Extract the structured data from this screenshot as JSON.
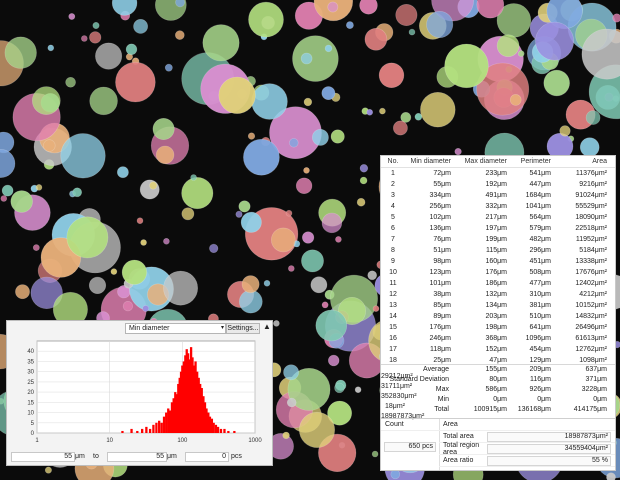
{
  "background": {
    "color": "#0b0b0b"
  },
  "results": {
    "columns": [
      "No.",
      "Min diameter",
      "Max diameter",
      "Perimeter",
      "Area"
    ],
    "rows": [
      [
        "1",
        "72μm",
        "233μm",
        "541μm",
        "11376μm²"
      ],
      [
        "2",
        "55μm",
        "192μm",
        "447μm",
        "9216μm²"
      ],
      [
        "3",
        "334μm",
        "491μm",
        "1684μm",
        "91024μm²"
      ],
      [
        "4",
        "256μm",
        "332μm",
        "1041μm",
        "55529μm²"
      ],
      [
        "5",
        "102μm",
        "217μm",
        "564μm",
        "18090μm²"
      ],
      [
        "6",
        "136μm",
        "197μm",
        "579μm",
        "22518μm²"
      ],
      [
        "7",
        "76μm",
        "199μm",
        "482μm",
        "11952μm²"
      ],
      [
        "8",
        "51μm",
        "115μm",
        "296μm",
        "5184μm²"
      ],
      [
        "9",
        "98μm",
        "160μm",
        "451μm",
        "13338μm²"
      ],
      [
        "10",
        "123μm",
        "176μm",
        "508μm",
        "17676μm²"
      ],
      [
        "11",
        "101μm",
        "186μm",
        "477μm",
        "12402μm²"
      ],
      [
        "12",
        "38μm",
        "132μm",
        "310μm",
        "4212μm²"
      ],
      [
        "13",
        "85μm",
        "134μm",
        "381μm",
        "10152μm²"
      ],
      [
        "14",
        "89μm",
        "203μm",
        "510μm",
        "14832μm²"
      ],
      [
        "15",
        "176μm",
        "198μm",
        "641μm",
        "26496μm²"
      ],
      [
        "16",
        "246μm",
        "368μm",
        "1096μm",
        "61613μm²"
      ],
      [
        "17",
        "118μm",
        "152μm",
        "454μm",
        "12762μm²"
      ],
      [
        "18",
        "25μm",
        "47μm",
        "129μm",
        "1098μm²"
      ],
      [
        "19",
        "178μm",
        "325μm",
        "873μm",
        "44945μm²"
      ],
      [
        "20",
        "64μm",
        "150μm",
        "391μm",
        "8424μm²"
      ],
      [
        "21",
        "143μm",
        "188μm",
        "569μm",
        "21474μm²"
      ]
    ],
    "stats": [
      [
        "Average",
        "155μm",
        "209μm",
        "637μm",
        "29212μm²"
      ],
      [
        "Standard Deviation",
        "80μm",
        "116μm",
        "371μm",
        "31711μm²"
      ],
      [
        "Max",
        "586μm",
        "926μm",
        "3228μm",
        "352830μm²"
      ],
      [
        "Min",
        "0μm",
        "0μm",
        "0μm",
        "18μm²"
      ],
      [
        "Total",
        "100915μm",
        "136168μm",
        "414175μm",
        "18987873μm²"
      ]
    ],
    "summary": {
      "count_label": "Count",
      "count_value": "650 pcs",
      "area_header": "Area",
      "total_area_label": "Total area",
      "total_area_value": "18987873μm²",
      "total_region_label": "Total region area",
      "total_region_value": "34559404μm²",
      "area_ratio_label": "Area ratio",
      "area_ratio_value": "55 %"
    }
  },
  "histogram": {
    "measure": "Min diameter",
    "settings_label": "Settings...",
    "collapse_glyph": "▲",
    "dropdown_glyph": "▾",
    "bar_color": "#ff0000",
    "range_from": "55",
    "range_unit": "μm",
    "range_to_label": "to",
    "range_to": "55",
    "range_unit2": "μm",
    "count_value": "0",
    "count_unit": "pcs"
  },
  "chart_data": {
    "type": "bar",
    "x_scale": "log",
    "xlim": [
      1,
      1000
    ],
    "ylim": [
      0,
      45
    ],
    "x_ticks": [
      "1",
      "10",
      "100",
      "1000"
    ],
    "y_ticks": [
      "0",
      "5",
      "10",
      "15",
      "20",
      "25",
      "30",
      "35",
      "40"
    ],
    "grid": true,
    "bins": [
      {
        "x": 15,
        "y": 1
      },
      {
        "x": 20,
        "y": 2
      },
      {
        "x": 24,
        "y": 1
      },
      {
        "x": 28,
        "y": 2
      },
      {
        "x": 32,
        "y": 3
      },
      {
        "x": 36,
        "y": 2
      },
      {
        "x": 40,
        "y": 4
      },
      {
        "x": 44,
        "y": 5
      },
      {
        "x": 48,
        "y": 6
      },
      {
        "x": 52,
        "y": 5
      },
      {
        "x": 56,
        "y": 8
      },
      {
        "x": 60,
        "y": 10
      },
      {
        "x": 64,
        "y": 12
      },
      {
        "x": 68,
        "y": 11
      },
      {
        "x": 72,
        "y": 15
      },
      {
        "x": 76,
        "y": 17
      },
      {
        "x": 80,
        "y": 20
      },
      {
        "x": 84,
        "y": 19
      },
      {
        "x": 88,
        "y": 24
      },
      {
        "x": 92,
        "y": 27
      },
      {
        "x": 96,
        "y": 30
      },
      {
        "x": 100,
        "y": 33
      },
      {
        "x": 105,
        "y": 35
      },
      {
        "x": 110,
        "y": 38
      },
      {
        "x": 115,
        "y": 41
      },
      {
        "x": 120,
        "y": 39
      },
      {
        "x": 126,
        "y": 36
      },
      {
        "x": 132,
        "y": 42
      },
      {
        "x": 138,
        "y": 37
      },
      {
        "x": 145,
        "y": 33
      },
      {
        "x": 152,
        "y": 35
      },
      {
        "x": 160,
        "y": 30
      },
      {
        "x": 168,
        "y": 27
      },
      {
        "x": 176,
        "y": 24
      },
      {
        "x": 185,
        "y": 22
      },
      {
        "x": 195,
        "y": 18
      },
      {
        "x": 205,
        "y": 15
      },
      {
        "x": 215,
        "y": 12
      },
      {
        "x": 228,
        "y": 10
      },
      {
        "x": 240,
        "y": 8
      },
      {
        "x": 255,
        "y": 7
      },
      {
        "x": 270,
        "y": 5
      },
      {
        "x": 290,
        "y": 4
      },
      {
        "x": 310,
        "y": 3
      },
      {
        "x": 340,
        "y": 2
      },
      {
        "x": 380,
        "y": 2
      },
      {
        "x": 430,
        "y": 1
      },
      {
        "x": 520,
        "y": 1
      }
    ]
  }
}
